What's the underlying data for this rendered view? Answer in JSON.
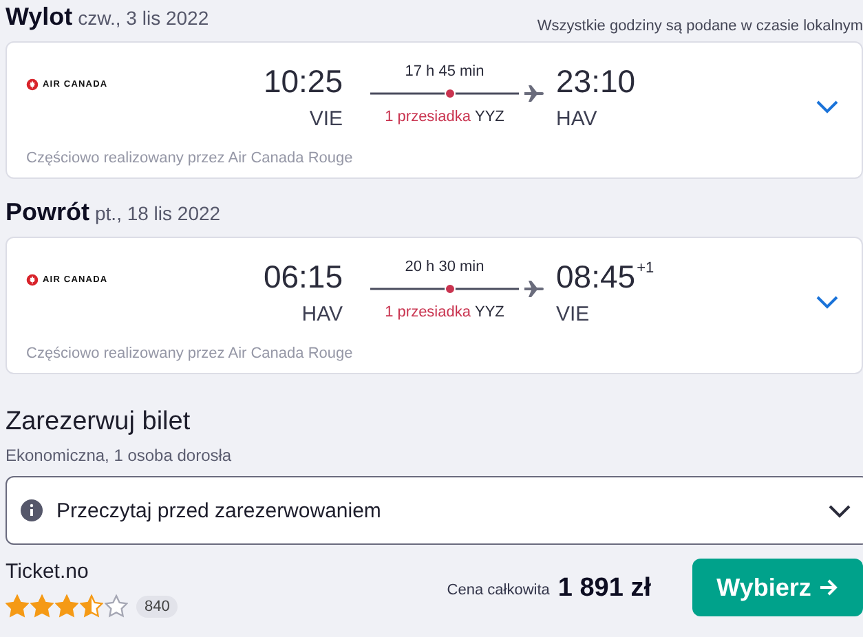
{
  "note": "Wszystkie godziny są podane w czasie lokalnym",
  "flights": [
    {
      "label": "Wylot",
      "date": "czw., 3 lis 2022",
      "airline": "AIR CANADA",
      "departure": {
        "time": "10:25",
        "airport": "VIE"
      },
      "duration": "17 h 45 min",
      "stops": "1 przesiadka",
      "via": "YYZ",
      "arrival": {
        "time": "23:10",
        "airport": "HAV"
      },
      "operated_by": "Częściowo realizowany przez Air Canada Rouge",
      "expanded": false
    },
    {
      "label": "Powrót",
      "date": "pt., 18 lis 2022",
      "airline": "AIR CANADA",
      "departure": {
        "time": "06:15",
        "airport": "HAV"
      },
      "duration": "20 h 30 min",
      "stops": "1 przesiadka",
      "via": "YYZ",
      "arrival": {
        "time": "08:45",
        "airport": "VIE",
        "day_offset": "+1"
      },
      "operated_by": "Częściowo realizowany przez Air Canada Rouge",
      "expanded": false
    }
  ],
  "booking": {
    "title": "Zarezerwuj bilet",
    "subtitle": "Ekonomiczna, 1 osoba dorosła",
    "info": {
      "label": "Przeczytaj przed zarezerwowaniem",
      "expanded": false
    },
    "provider": "Ticket.no",
    "stars": 3.5,
    "reviews": "840",
    "price_label": "Cena całkowita",
    "price": "1 891 zł",
    "button": "Wybierz"
  }
}
